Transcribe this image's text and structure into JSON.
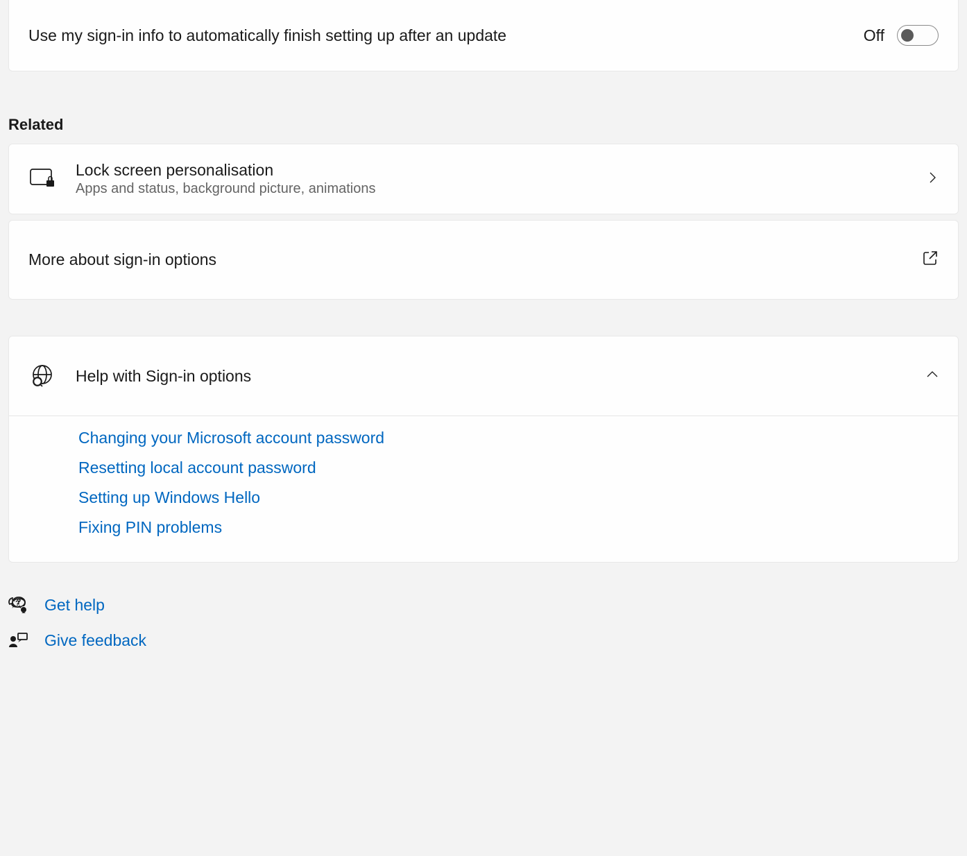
{
  "settings": {
    "auto_finish_setup": {
      "label": "Use my sign-in info to automatically finish setting up after an update",
      "state": "Off",
      "on": false
    }
  },
  "related": {
    "heading": "Related",
    "lock_screen": {
      "title": "Lock screen personalisation",
      "subtitle": "Apps and status, background picture, animations"
    },
    "more_about": {
      "title": "More about sign-in options"
    }
  },
  "help": {
    "title": "Help with Sign-in options",
    "links": [
      "Changing your Microsoft account password",
      "Resetting local account password",
      "Setting up Windows Hello",
      "Fixing PIN problems"
    ]
  },
  "footer": {
    "get_help": "Get help",
    "give_feedback": "Give feedback"
  },
  "colors": {
    "link": "#0067c0",
    "background": "#f3f3f3",
    "card": "#fefefe"
  }
}
